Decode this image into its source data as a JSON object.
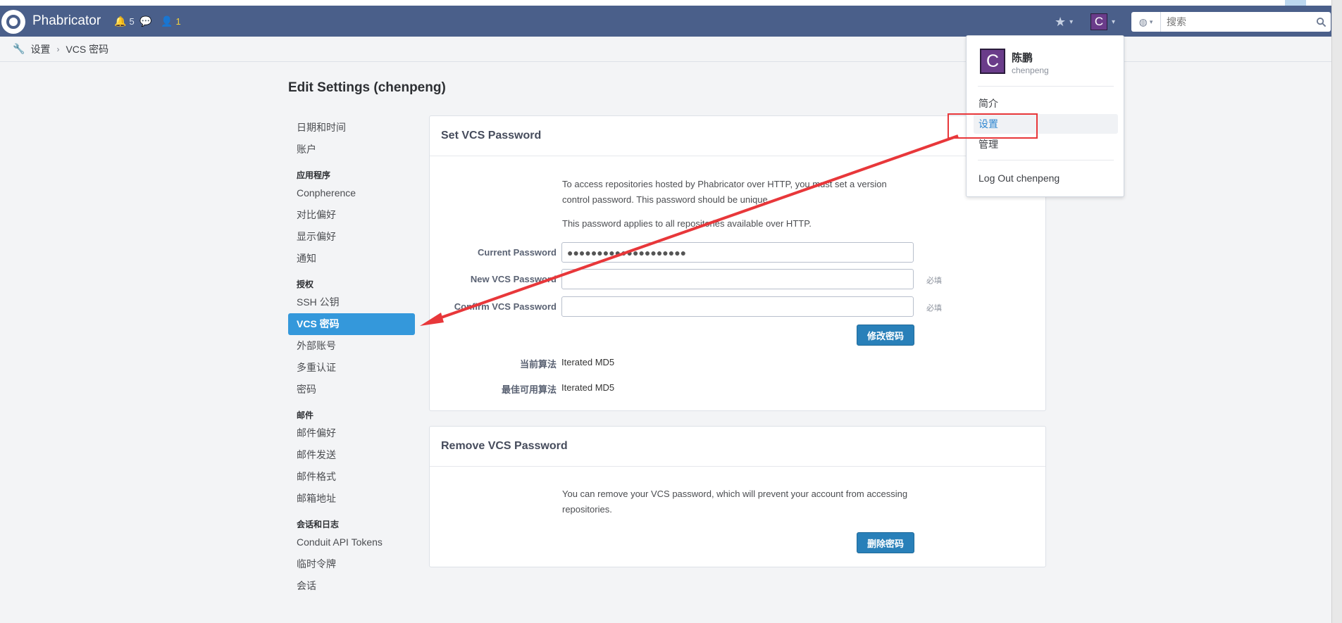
{
  "topbar": {
    "brand": "Phabricator",
    "notifications": [
      {
        "icon": "bell-icon",
        "glyph": "🔔",
        "count": "5"
      },
      {
        "icon": "chat-icon",
        "glyph": "💬",
        "count": ""
      },
      {
        "icon": "user-icon",
        "glyph": "👤",
        "count": "1"
      }
    ],
    "avatar_letter": "C",
    "search": {
      "placeholder": "搜索",
      "value": ""
    }
  },
  "breadcrumb": {
    "root": "设置",
    "current": "VCS 密码"
  },
  "page": {
    "title": "Edit Settings (chenpeng)"
  },
  "sidebar": [
    {
      "type": "item",
      "label": "日期和时间"
    },
    {
      "type": "item",
      "label": "账户"
    },
    {
      "type": "head",
      "label": "应用程序"
    },
    {
      "type": "item",
      "label": "Conpherence"
    },
    {
      "type": "item",
      "label": "对比偏好"
    },
    {
      "type": "item",
      "label": "显示偏好"
    },
    {
      "type": "item",
      "label": "通知"
    },
    {
      "type": "head",
      "label": "授权"
    },
    {
      "type": "item",
      "label": "SSH 公钥"
    },
    {
      "type": "item",
      "label": "VCS 密码",
      "active": true
    },
    {
      "type": "item",
      "label": "外部账号"
    },
    {
      "type": "item",
      "label": "多重认证"
    },
    {
      "type": "item",
      "label": "密码"
    },
    {
      "type": "head",
      "label": "邮件"
    },
    {
      "type": "item",
      "label": "邮件偏好"
    },
    {
      "type": "item",
      "label": "邮件发送"
    },
    {
      "type": "item",
      "label": "邮件格式"
    },
    {
      "type": "item",
      "label": "邮箱地址"
    },
    {
      "type": "head",
      "label": "会话和日志"
    },
    {
      "type": "item",
      "label": "Conduit API Tokens"
    },
    {
      "type": "item",
      "label": "临时令牌"
    },
    {
      "type": "item",
      "label": "会话"
    }
  ],
  "set_panel": {
    "title": "Set VCS Password",
    "intro1": "To access repositories hosted by Phabricator over HTTP, you must set a version control password. This password should be unique.",
    "intro2": "This password applies to all repositories available over HTTP.",
    "current_label": "Current Password",
    "current_value": "●●●●●●●●●●●●●●●●●●●●",
    "new_label": "New VCS Password",
    "confirm_label": "Confirm VCS Password",
    "required": "必填",
    "submit": "修改密码",
    "algo_label": "当前算法",
    "algo_value": "Iterated MD5",
    "best_label": "最佳可用算法",
    "best_value": "Iterated MD5"
  },
  "remove_panel": {
    "title": "Remove VCS Password",
    "text": "You can remove your VCS password, which will prevent your account from accessing repositories.",
    "button": "删除密码"
  },
  "user_menu": {
    "avatar_letter": "C",
    "name": "陈鹏",
    "username": "chenpeng",
    "items": [
      "简介",
      "设置",
      "管理"
    ],
    "logout": "Log Out chenpeng"
  },
  "colors": {
    "topbar": "#4a5f8a",
    "accent": "#3498db",
    "annotation": "#e8373a"
  }
}
